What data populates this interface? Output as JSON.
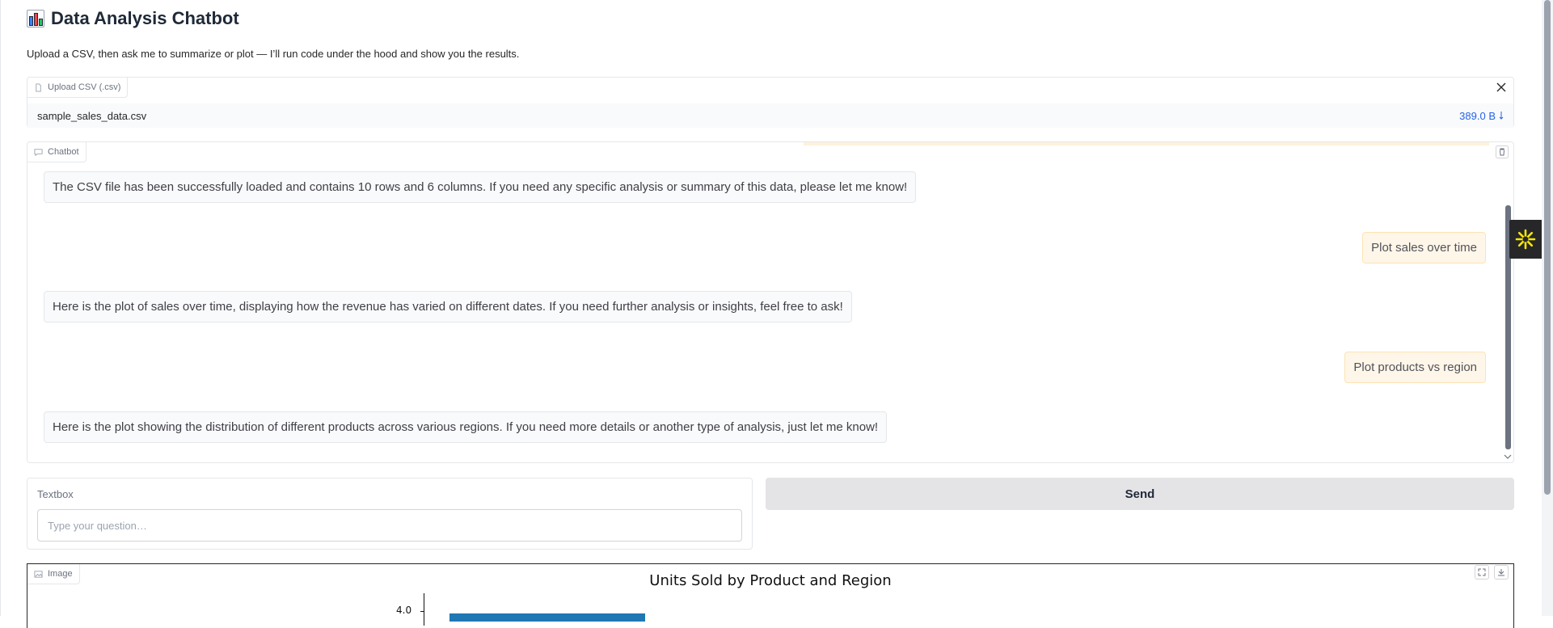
{
  "header": {
    "title": "Data Analysis Chatbot",
    "subtitle": "Upload a CSV, then ask me to summarize or plot — I’ll run code under the hood and show you the results."
  },
  "upload": {
    "label": "Upload CSV (.csv)",
    "file_name": "sample_sales_data.csv",
    "file_size": "389.0 B"
  },
  "chatbot": {
    "label": "Chatbot",
    "messages": [
      {
        "role": "bot",
        "text": "The CSV file has been successfully loaded and contains 10 rows and 6 columns. If you need any specific analysis or summary of this data, please let me know!"
      },
      {
        "role": "user",
        "text": "Plot sales over time"
      },
      {
        "role": "bot",
        "text": "Here is the plot of sales over time, displaying how the revenue has varied on different dates. If you need further analysis or insights, feel free to ask!"
      },
      {
        "role": "user",
        "text": "Plot products vs region"
      },
      {
        "role": "bot",
        "text": "Here is the plot showing the distribution of different products across various regions. If you need more details or another type of analysis, just let me know!"
      }
    ]
  },
  "textbox": {
    "label": "Textbox",
    "placeholder": "Type your question…",
    "value": ""
  },
  "send_button": {
    "label": "Send"
  },
  "image_panel": {
    "label": "Image",
    "chart_data": {
      "type": "bar",
      "title": "Units Sold by Product and Region",
      "visible_ytick": "4.0",
      "bar_color": "#1f77b4"
    }
  },
  "colors": {
    "accent_link": "#2563eb",
    "user_bubble": "#fef6e8",
    "bot_bubble": "#f9fafb",
    "side_widget_icon": "#f5e50a"
  }
}
